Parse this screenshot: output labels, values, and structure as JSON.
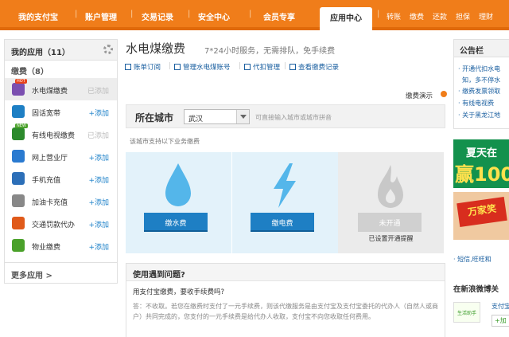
{
  "nav": {
    "items": [
      "我的支付宝",
      "账户管理",
      "交易记录",
      "安全中心",
      "会员专享"
    ],
    "active": "应用中心",
    "extra": [
      "转账",
      "缴费",
      "还款",
      "担保",
      "理财"
    ]
  },
  "sidebar": {
    "title": "我的应用（11）",
    "section": "缴费（8）",
    "items": [
      {
        "label": "水电煤缴费",
        "action": "已添加",
        "badge": "HOT",
        "color": "#7b4fb0"
      },
      {
        "label": "固话宽带",
        "action": "+添加",
        "badge": "",
        "color": "#1e7fc4"
      },
      {
        "label": "有线电视缴费",
        "action": "已添加",
        "badge": "NEW",
        "color": "#2c8a2c"
      },
      {
        "label": "网上营业厅",
        "action": "+添加",
        "badge": "",
        "color": "#2a7ad0"
      },
      {
        "label": "手机充值",
        "action": "+添加",
        "badge": "",
        "color": "#2c6fb8"
      },
      {
        "label": "加油卡充值",
        "action": "+添加",
        "badge": "",
        "color": "#888888"
      },
      {
        "label": "交通罚款代办",
        "action": "+添加",
        "badge": "",
        "color": "#e05a1a"
      },
      {
        "label": "物业缴费",
        "action": "+添加",
        "badge": "",
        "color": "#4aa12a"
      }
    ],
    "more": "更多应用 >"
  },
  "main": {
    "title": "水电煤缴费",
    "subtitle": "7*24小时服务，无需排队，免手续费",
    "links": [
      "账单订阅",
      "管理水电煤账号",
      "代扣管理",
      "查看缴费记录"
    ],
    "demo": "缴费演示",
    "city_label": "所在城市",
    "city_value": "武汉",
    "city_hint": "可直接输入城市或城市拼音",
    "support_text": "该城市支持以下业务缴费",
    "cards": [
      {
        "button": "缴水费",
        "note": ""
      },
      {
        "button": "缴电费",
        "note": ""
      },
      {
        "button": "未开通",
        "note": "已设置开通提醒"
      }
    ],
    "faq": {
      "heading": "使用遇到问题?",
      "question": "用支付宝缴费，要收手续费吗?",
      "answer": "答：不收取。若您在缴费时支付了一元手续费，则该代缴服务是由支付宝及支付宝委托的代办人（自然人或商户）共同完成的，您支付的一元手续费是给代办人收取，支付宝不向您收取任何费用。"
    }
  },
  "right": {
    "notice_title": "公告栏",
    "notices": [
      "开通代扣水电",
      "知，多不停水",
      "缴费发票领取",
      "有线电视费",
      "关于黑龙江地"
    ],
    "banner1_top": "夏天在",
    "banner1_bottom": "赢100",
    "banner2_text": "万家笑",
    "link": "短信,旺旺和",
    "sina_title": "在新浪微博关",
    "sina_logo": "生活助手",
    "sina_text": "支付宝",
    "sina_add": "+加"
  },
  "colors": {
    "nav": "#f07d1a",
    "link": "#1a5fa0",
    "primary_button": "#1e7fc4"
  }
}
